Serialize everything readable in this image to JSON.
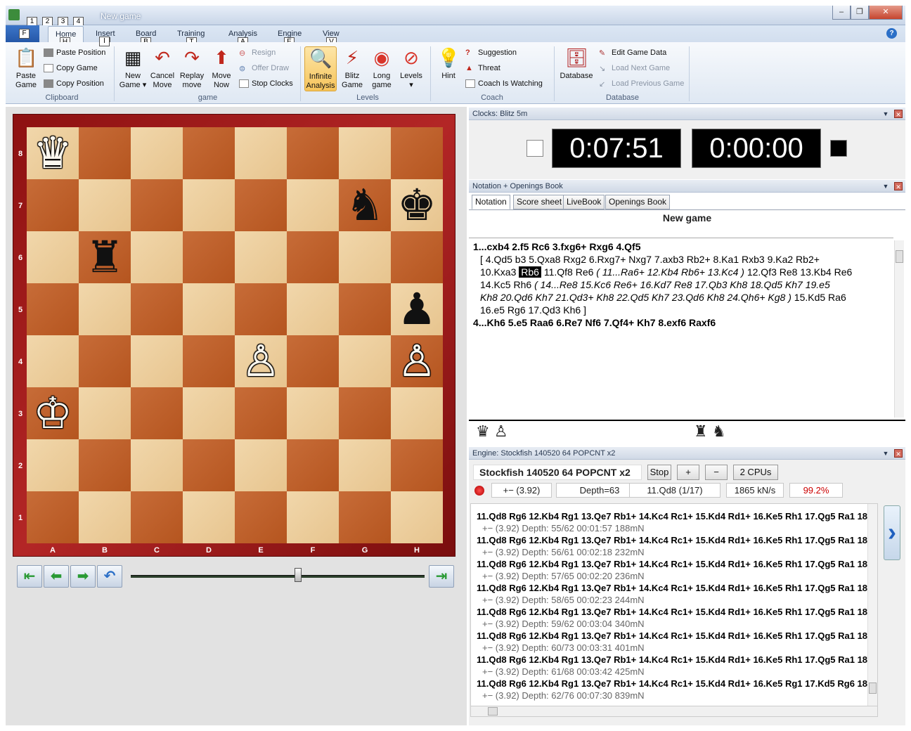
{
  "window": {
    "title": "New game"
  },
  "quick_access": {
    "keytips": [
      "1",
      "2",
      "3",
      "4"
    ],
    "file_keytip": "F",
    "buttons": [
      "minimize",
      "restore",
      "close"
    ]
  },
  "ribbon_tabs": [
    {
      "label": "Home",
      "keytip": "H"
    },
    {
      "label": "Insert",
      "keytip": "I"
    },
    {
      "label": "Board",
      "keytip": "B"
    },
    {
      "label": "Training",
      "keytip": "T"
    },
    {
      "label": "Analysis",
      "keytip": "A"
    },
    {
      "label": "Engine",
      "keytip": "E"
    },
    {
      "label": "View",
      "keytip": "V"
    }
  ],
  "ribbon": {
    "clipboard": {
      "label": "Clipboard",
      "paste_game": "Paste Game",
      "paste_position": "Paste Position",
      "copy_game": "Copy Game",
      "copy_position": "Copy Position"
    },
    "game": {
      "label": "game",
      "new_game": "New Game",
      "cancel_move": "Cancel Move",
      "replay_move": "Replay move",
      "move_now": "Move Now",
      "resign": "Resign",
      "offer_draw": "Offer Draw",
      "stop_clocks": "Stop Clocks"
    },
    "levels": {
      "label": "Levels",
      "infinite_analysis": "Infinite Analysis",
      "blitz_game": "Blitz Game",
      "long_game": "Long game",
      "levels": "Levels"
    },
    "coach": {
      "label": "Coach",
      "hint": "Hint",
      "suggestion": "Suggestion",
      "threat": "Threat",
      "coach_is_watching": "Coach Is Watching"
    },
    "database": {
      "label": "Database",
      "database": "Database",
      "edit_game_data": "Edit Game Data",
      "load_next_game": "Load Next Game",
      "load_previous_game": "Load Previous Game"
    }
  },
  "board": {
    "ranks": [
      "8",
      "7",
      "6",
      "5",
      "4",
      "3",
      "2",
      "1"
    ],
    "files": [
      "A",
      "B",
      "C",
      "D",
      "E",
      "F",
      "G",
      "H"
    ],
    "pieces": [
      {
        "square": "a8",
        "glyph": "♛",
        "color": "w",
        "name": "white-queen"
      },
      {
        "square": "g7",
        "glyph": "♞",
        "color": "b",
        "name": "black-knight"
      },
      {
        "square": "h7",
        "glyph": "♚",
        "color": "b",
        "name": "black-king"
      },
      {
        "square": "b6",
        "glyph": "♜",
        "color": "b",
        "name": "black-rook"
      },
      {
        "square": "h5",
        "glyph": "♟",
        "color": "b",
        "name": "black-pawn"
      },
      {
        "square": "e4",
        "glyph": "♙",
        "color": "w",
        "name": "white-pawn"
      },
      {
        "square": "h4",
        "glyph": "♙",
        "color": "w",
        "name": "white-pawn"
      },
      {
        "square": "a3",
        "glyph": "♔",
        "color": "w",
        "name": "white-king"
      }
    ],
    "slider_position": 0.57
  },
  "clocks": {
    "title": "Clocks: Blitz 5m",
    "white_time": "0:07:51",
    "black_time": "0:00:00"
  },
  "notation": {
    "title": "Notation + Openings Book",
    "tabs": [
      "Notation",
      "Score sheet",
      "LiveBook",
      "Openings Book"
    ],
    "game_title": "New game",
    "line1": "1...cxb4  2.f5  Rc6  3.fxg6+  Rxg6  4.Qf5",
    "line2": "[ 4.Qd5  b3  5.Qxa8  Rxg2  6.Rxg7+  Nxg7  7.axb3  Rb2+  8.Ka1  Rxb3  9.Ka2  Rb2+",
    "line3_pre": "10.Kxa3",
    "line3_hl": "Rb6",
    "line3_post": "11.Qf8  Re6",
    "line3_it": "( 11...Ra6+  12.Kb4  Rb6+  13.Kc4 )",
    "line3_end": "12.Qf3  Re8  13.Kb4  Re6",
    "line4_pre": "14.Kc5  Rh6",
    "line4_it": "( 14...Re8  15.Kc6  Re6+  16.Kd7  Re8  17.Qb3  Kh8  18.Qd5  Kh7  19.e5",
    "line5_it": "Kh8  20.Qd6  Kh7  21.Qd3+  Kh8  22.Qd5  Kh7  23.Qd6  Kh8  24.Qh6+  Kg8 )",
    "line5_end": "15.Kd5  Ra6",
    "line6": "16.e5  Rg6  17.Qd3  Kh6 ]",
    "line7": "4...Kh6  5.e5  Raa6  6.Re7  Nf6  7.Qf4+  Kh7  8.exf6  Raxf6",
    "material_white": "♛ ♙",
    "material_black": "♜ ♞"
  },
  "engine": {
    "title": "Engine: Stockfish 140520 64 POPCNT x2",
    "name": "Stockfish 140520 64 POPCNT x2",
    "stop": "Stop",
    "plus": "+",
    "minus": "−",
    "cpus": "2 CPUs",
    "eval": "+−  (3.92)",
    "depth": "Depth=63",
    "current_move": "11.Qd8 (1/17)",
    "speed": "1865 kN/s",
    "load": "99.2%",
    "lines": [
      {
        "pv": "11.Qd8 Rg6 12.Kb4 Rg1 13.Qe7 Rb1+ 14.Kc4 Rc1+ 15.Kd4 Rd1+ 16.Ke5 Rh1 17.Qg5 Ra1 18",
        "info": "+−  (3.92)   Depth: 55/62   00:01:57  188mN"
      },
      {
        "pv": "11.Qd8 Rg6 12.Kb4 Rg1 13.Qe7 Rb1+ 14.Kc4 Rc1+ 15.Kd4 Rd1+ 16.Ke5 Rh1 17.Qg5 Ra1 18",
        "info": "+−  (3.92)   Depth: 56/61   00:02:18  232mN"
      },
      {
        "pv": "11.Qd8 Rg6 12.Kb4 Rg1 13.Qe7 Rb1+ 14.Kc4 Rc1+ 15.Kd4 Rd1+ 16.Ke5 Rh1 17.Qg5 Ra1 18",
        "info": "+−  (3.92)   Depth: 57/65   00:02:20  236mN"
      },
      {
        "pv": "11.Qd8 Rg6 12.Kb4 Rg1 13.Qe7 Rb1+ 14.Kc4 Rc1+ 15.Kd4 Rd1+ 16.Ke5 Rh1 17.Qg5 Ra1 18",
        "info": "+−  (3.92)   Depth: 58/65   00:02:23  244mN"
      },
      {
        "pv": "11.Qd8 Rg6 12.Kb4 Rg1 13.Qe7 Rb1+ 14.Kc4 Rc1+ 15.Kd4 Rd1+ 16.Ke5 Rh1 17.Qg5 Ra1 18",
        "info": "+−  (3.92)   Depth: 59/62   00:03:04  340mN"
      },
      {
        "pv": "11.Qd8 Rg6 12.Kb4 Rg1 13.Qe7 Rb1+ 14.Kc4 Rc1+ 15.Kd4 Rd1+ 16.Ke5 Rh1 17.Qg5 Ra1 18",
        "info": "+−  (3.92)   Depth: 60/73   00:03:31  401mN"
      },
      {
        "pv": "11.Qd8 Rg6 12.Kb4 Rg1 13.Qe7 Rb1+ 14.Kc4 Rc1+ 15.Kd4 Rd1+ 16.Ke5 Rh1 17.Qg5 Ra1 18",
        "info": "+−  (3.92)   Depth: 61/68   00:03:42  425mN"
      },
      {
        "pv": "11.Qd8 Rg6 12.Kb4 Rg1 13.Qe7 Rb1+ 14.Kc4 Rc1+ 15.Kd4 Rd1+ 16.Ke5 Rg1 17.Kd5 Rg6 18",
        "info": "+−  (3.92)   Depth: 62/76   00:07:30  839mN"
      }
    ]
  }
}
